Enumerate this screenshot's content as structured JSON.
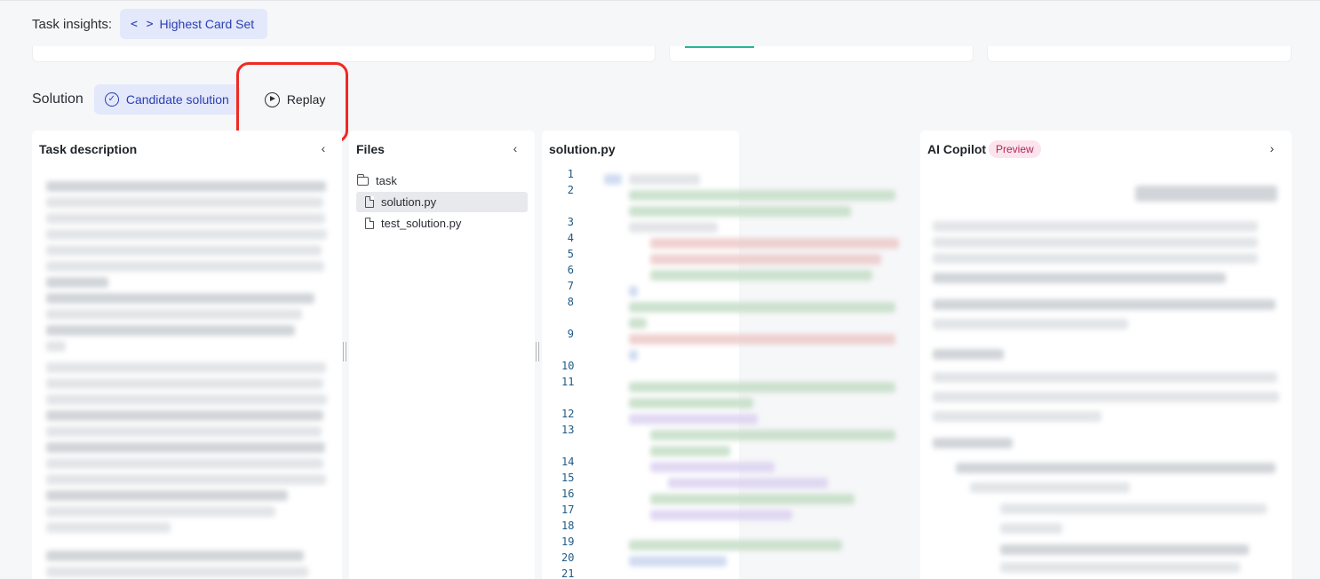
{
  "header": {
    "insights_label": "Task insights:",
    "insights_chip_label": "Highest Card Set"
  },
  "solution_bar": {
    "label": "Solution",
    "candidate_label": "Candidate solution",
    "replay_label": "Replay"
  },
  "panels": {
    "task_description_title": "Task description",
    "files_title": "Files",
    "code_title": "solution.py",
    "copilot_title": "AI Copilot",
    "copilot_badge": "Preview"
  },
  "files": {
    "folder": "task",
    "items": [
      "solution.py",
      "test_solution.py"
    ],
    "selected": "solution.py"
  },
  "code": {
    "line_numbers": [
      "1",
      "2",
      "3",
      "4",
      "5",
      "6",
      "7",
      "8",
      "9",
      "10",
      "11",
      "12",
      "13",
      "14",
      "15",
      "16",
      "17",
      "18",
      "19",
      "20",
      "21"
    ]
  },
  "colors": {
    "accent_chip_bg": "#e3e8fb",
    "accent_chip_text": "#2b3fb3",
    "highlight": "#ee2a22",
    "preview_badge_bg": "#fbe4ec",
    "preview_badge_text": "#b0265a"
  },
  "icons": {
    "insights_chip": "code-brackets-icon",
    "candidate": "check-circle-icon",
    "replay": "play-circle-icon",
    "collapse": "chevron-left-icon",
    "expand": "chevron-right-icon",
    "folder": "folder-icon",
    "file": "file-icon"
  }
}
